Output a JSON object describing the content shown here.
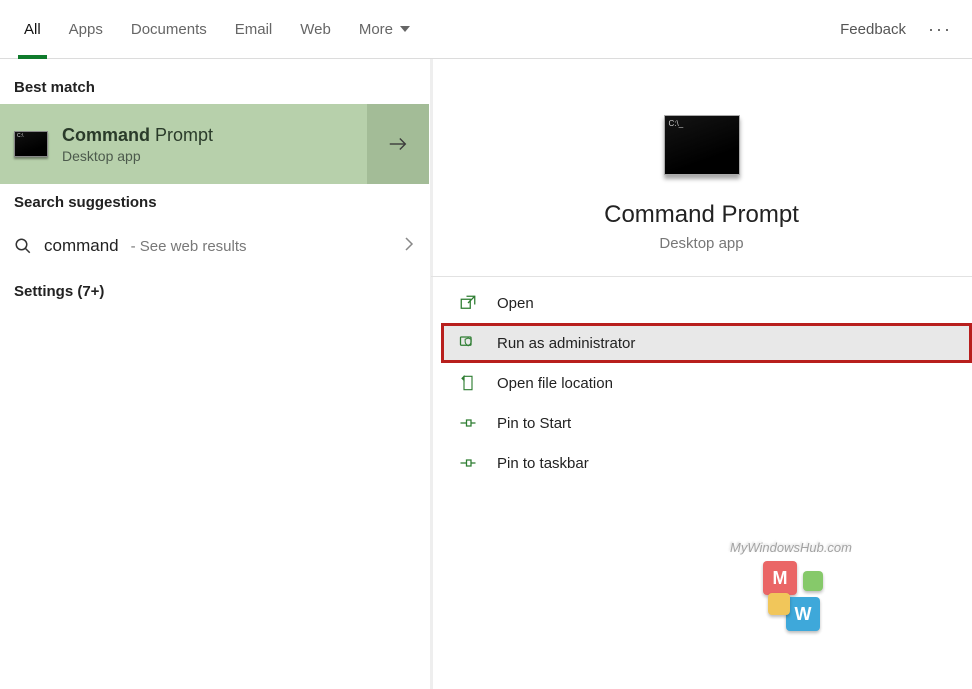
{
  "tabs": {
    "items": [
      {
        "label": "All",
        "active": true
      },
      {
        "label": "Apps"
      },
      {
        "label": "Documents"
      },
      {
        "label": "Email"
      },
      {
        "label": "Web"
      },
      {
        "label": "More",
        "dropdown": true
      }
    ],
    "feedback": "Feedback",
    "more_glyph": "···"
  },
  "left": {
    "best_match_label": "Best match",
    "best_match": {
      "title_bold": "Command",
      "title_rest": " Prompt",
      "subtitle": "Desktop app"
    },
    "suggestions_label": "Search suggestions",
    "suggestion": {
      "query": "command",
      "trailer": " - See web results"
    },
    "settings_label": "Settings (7+)"
  },
  "right": {
    "title": "Command Prompt",
    "subtitle": "Desktop app",
    "actions": [
      {
        "icon": "open",
        "label": "Open"
      },
      {
        "icon": "admin",
        "label": "Run as administrator",
        "highlighted": true
      },
      {
        "icon": "folder",
        "label": "Open file location"
      },
      {
        "icon": "pin-start",
        "label": "Pin to Start"
      },
      {
        "icon": "pin-taskbar",
        "label": "Pin to taskbar"
      }
    ]
  },
  "watermark": {
    "text": "MyWindowsHub.com"
  }
}
